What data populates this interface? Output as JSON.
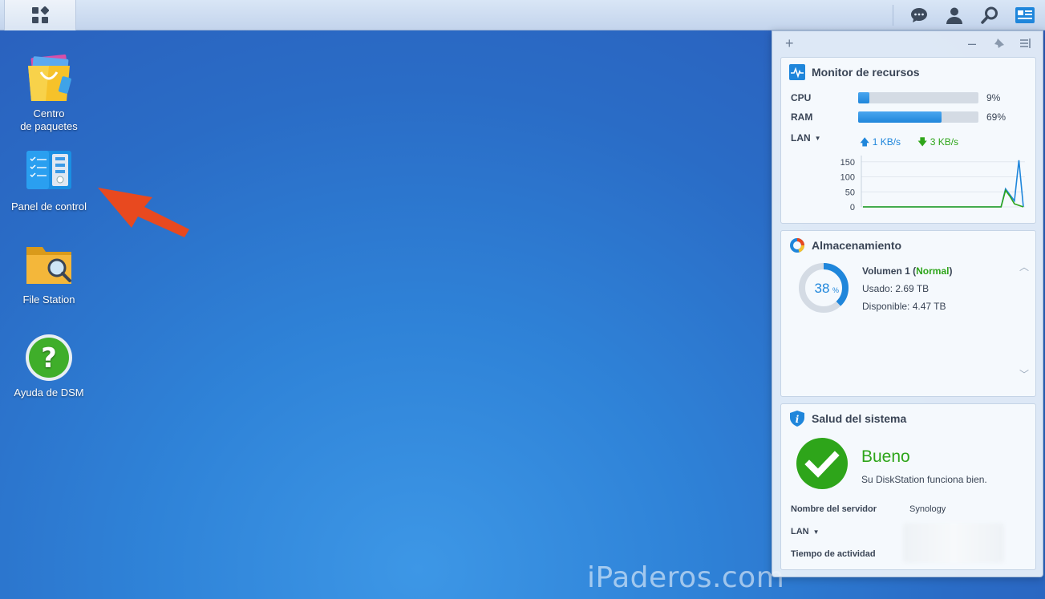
{
  "taskbar": {
    "icons": [
      "main-menu-icon",
      "chat-icon",
      "user-icon",
      "search-icon",
      "widgets-icon"
    ]
  },
  "desktop": {
    "icons": [
      {
        "label": "Centro\nde paquetes",
        "icon": "package-center-icon"
      },
      {
        "label": "Panel de control",
        "icon": "control-panel-icon"
      },
      {
        "label": "File Station",
        "icon": "file-station-icon"
      },
      {
        "label": "Ayuda de DSM",
        "icon": "help-icon"
      }
    ]
  },
  "widget_panel": {
    "toolbar": {
      "add": "+",
      "minimize": "–"
    },
    "resource_monitor": {
      "title": "Monitor de recursos",
      "cpu": {
        "label": "CPU",
        "value": "9%",
        "fraction": 0.09
      },
      "ram": {
        "label": "RAM",
        "value": "69%",
        "fraction": 0.69
      },
      "lan": {
        "label": "LAN",
        "upload": "1 KB/s",
        "download": "3 KB/s"
      },
      "chart_data": {
        "type": "line",
        "y_ticks": [
          "150",
          "100",
          "50",
          "0"
        ],
        "ylim": [
          0,
          160
        ],
        "series": [
          {
            "color": "#1f86db",
            "values": [
              0,
              0,
              0,
              0,
              0,
              0,
              0,
              0,
              0,
              0,
              0,
              0,
              0,
              0,
              0,
              0,
              0,
              0,
              0,
              0,
              0,
              0,
              0,
              0,
              0,
              0,
              0,
              0,
              0,
              0,
              0,
              0,
              60,
              40,
              20,
              155,
              0
            ]
          },
          {
            "color": "#2ea51a",
            "values": [
              0,
              0,
              0,
              0,
              0,
              0,
              0,
              0,
              0,
              0,
              0,
              0,
              0,
              0,
              0,
              0,
              0,
              0,
              0,
              0,
              0,
              0,
              0,
              0,
              0,
              0,
              0,
              0,
              0,
              0,
              0,
              0,
              55,
              35,
              10,
              5,
              0
            ]
          }
        ]
      }
    },
    "storage": {
      "title": "Almacenamiento",
      "volume_name": "Volumen 1",
      "volume_status": "Normal",
      "used": "Usado: 2.69 TB",
      "available": "Disponible: 4.47 TB",
      "percent": "38",
      "percent_sign": "%",
      "fraction": 0.38
    },
    "health": {
      "title": "Salud del sistema",
      "status": "Bueno",
      "description": "Su DiskStation funciona bien.",
      "server_name_label": "Nombre del servidor",
      "server_name": "Synology",
      "lan_label": "LAN",
      "uptime_label": "Tiempo de actividad"
    }
  },
  "watermark": "iPaderos.com",
  "colors": {
    "accent": "#1f86db",
    "ok": "#2ea51a",
    "arrow": "#e8491f"
  }
}
